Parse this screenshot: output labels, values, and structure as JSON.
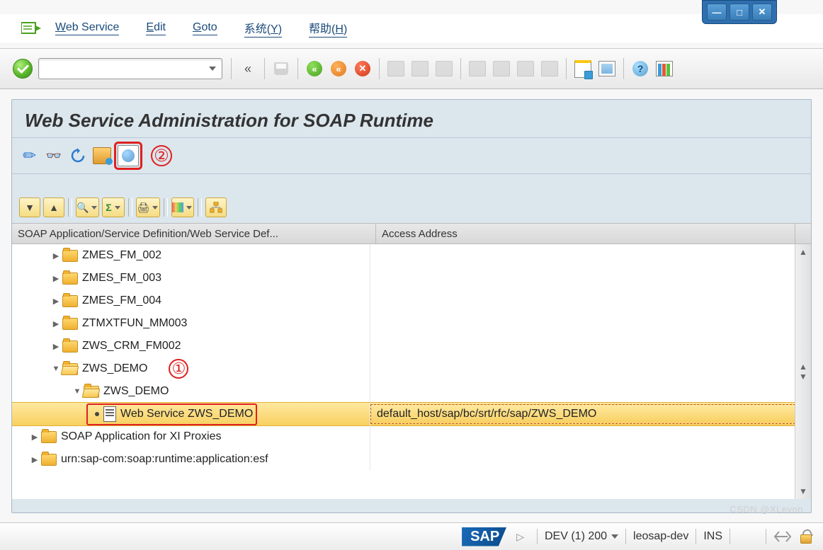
{
  "window_controls": {
    "minimize": "—",
    "maximize": "□",
    "close": "✕"
  },
  "menubar": {
    "items": [
      {
        "pre": "",
        "u": "W",
        "post": "eb Service"
      },
      {
        "pre": "",
        "u": "E",
        "post": "dit"
      },
      {
        "pre": "",
        "u": "G",
        "post": "oto"
      },
      {
        "pre": "系统(",
        "u": "Y",
        "post": ")"
      },
      {
        "pre": "帮助(",
        "u": "H",
        "post": ")"
      }
    ]
  },
  "page": {
    "title": "Web Service Administration for SOAP Runtime",
    "callout_toolbar": "②"
  },
  "grid": {
    "columns": {
      "col1": "SOAP Application/Service Definition/Web Service Def...",
      "col2": "Access Address"
    },
    "rows": [
      {
        "indent": 55,
        "expander": "▶",
        "icon": "folder",
        "label": "ZMES_FM_002",
        "addr": ""
      },
      {
        "indent": 55,
        "expander": "▶",
        "icon": "folder",
        "label": "ZMES_FM_003",
        "addr": ""
      },
      {
        "indent": 55,
        "expander": "▶",
        "icon": "folder",
        "label": "ZMES_FM_004",
        "addr": ""
      },
      {
        "indent": 55,
        "expander": "▶",
        "icon": "folder",
        "label": "ZTMXTFUN_MM003",
        "addr": ""
      },
      {
        "indent": 55,
        "expander": "▶",
        "icon": "folder",
        "label": "ZWS_CRM_FM002",
        "addr": ""
      },
      {
        "indent": 55,
        "expander": "▼",
        "icon": "folder-open",
        "label": "ZWS_DEMO",
        "addr": "",
        "callout": "①"
      },
      {
        "indent": 85,
        "expander": "▼",
        "icon": "folder-open",
        "label": "ZWS_DEMO",
        "addr": ""
      },
      {
        "indent": 105,
        "expander": "",
        "icon": "doc",
        "label": "Web Service ZWS_DEMO",
        "addr": "default_host/sap/bc/srt/rfc/sap/ZWS_DEMO",
        "selected": true
      },
      {
        "indent": 25,
        "expander": "▶",
        "icon": "folder",
        "label": "SOAP Application for XI Proxies",
        "addr": ""
      },
      {
        "indent": 25,
        "expander": "▶",
        "icon": "folder",
        "label": "urn:sap-com:soap:runtime:application:esf",
        "addr": ""
      }
    ]
  },
  "statusbar": {
    "logo": "SAP",
    "system": "DEV (1) 200",
    "server": "leosap-dev",
    "mode": "INS"
  },
  "watermark": "CSDN @XLevon"
}
